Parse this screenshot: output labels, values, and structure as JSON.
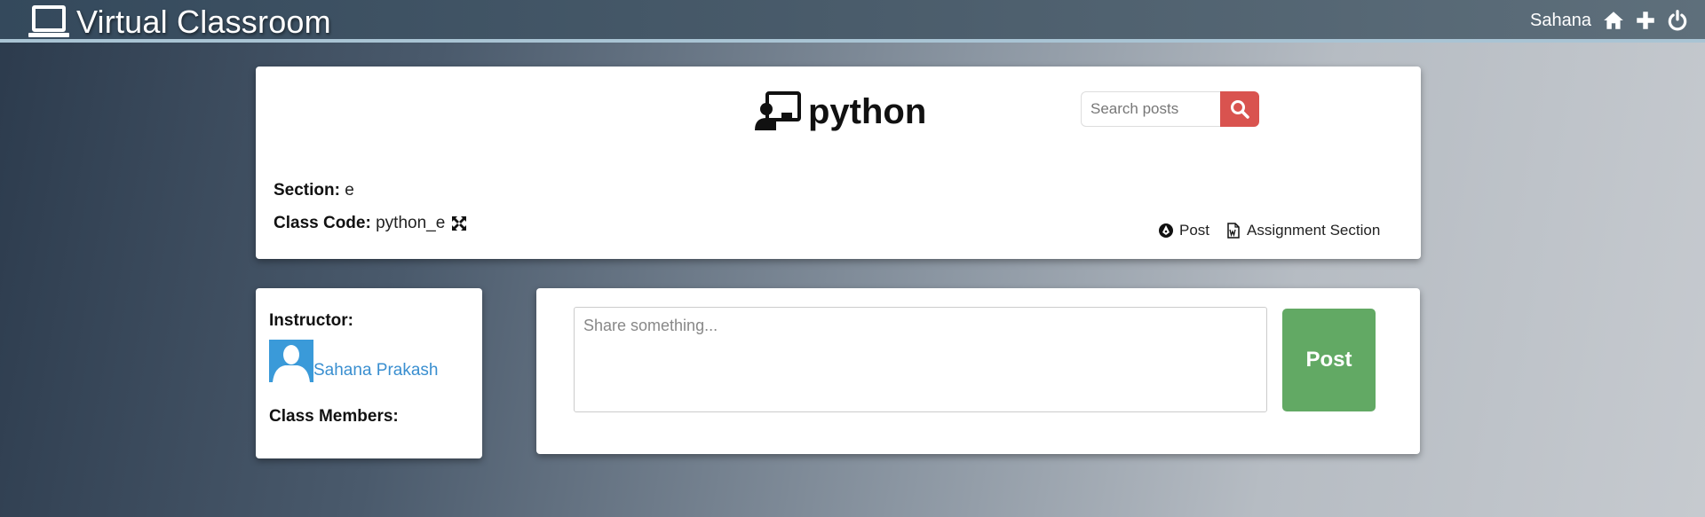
{
  "app": {
    "title": "Virtual Classroom",
    "icon": "laptop-icon"
  },
  "nav": {
    "user": "Sahana",
    "icons": [
      "home-icon",
      "plus-icon",
      "power-icon"
    ]
  },
  "class": {
    "name": "python",
    "icon": "chalkboard-teacher-icon",
    "section_label": "Section:",
    "section_value": "e",
    "code_label": "Class Code:",
    "code_value": "python_e"
  },
  "search": {
    "placeholder": "Search posts",
    "button_color": "#d9534f"
  },
  "links": {
    "post": "Post",
    "assignment": "Assignment Section"
  },
  "instructor": {
    "label": "Instructor:",
    "name": "Sahana Prakash",
    "members_label": "Class Members:"
  },
  "composer": {
    "placeholder": "Share something...",
    "post_button": "Post",
    "post_button_color": "#62a964"
  },
  "colors": {
    "link": "#3a8fd0",
    "avatar": "#3a9ad9",
    "topbar_border": "#a9c4d4"
  }
}
